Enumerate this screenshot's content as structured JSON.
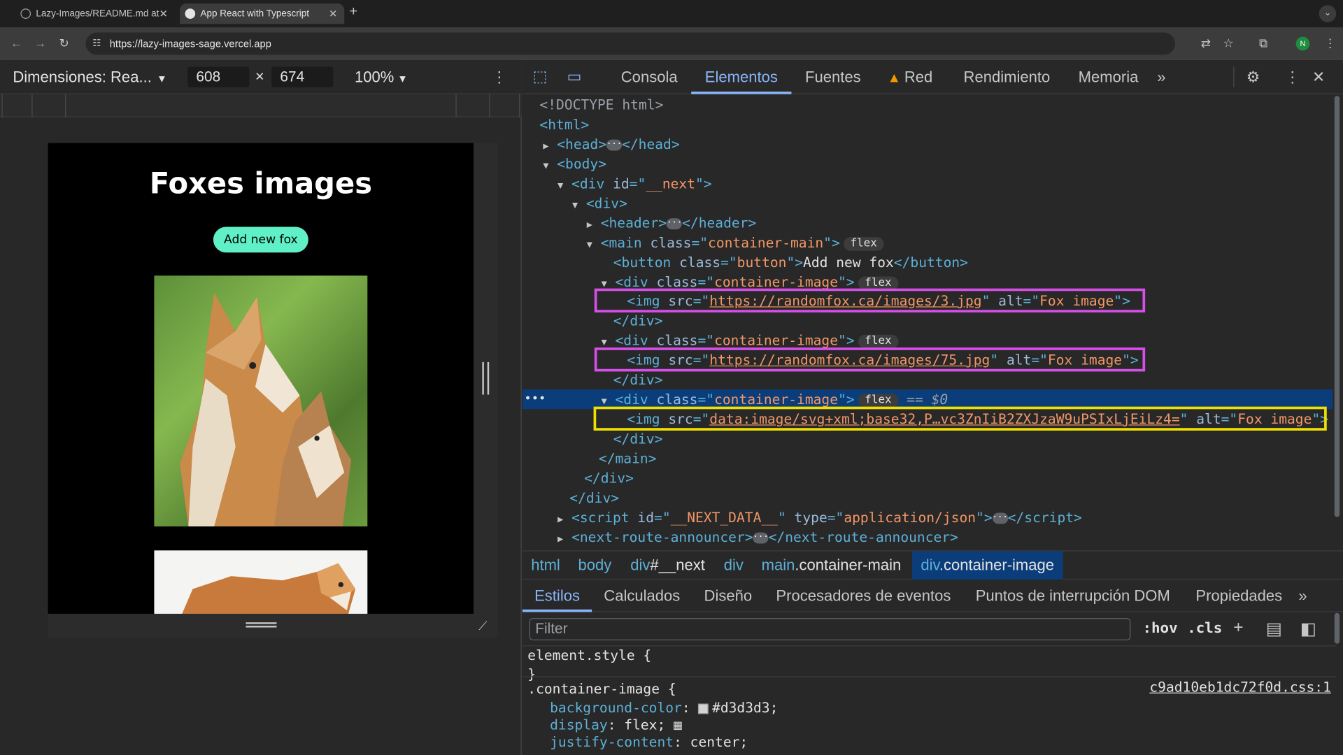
{
  "browser": {
    "tabs": [
      {
        "title": "Lazy-Images/README.md at",
        "active": false
      },
      {
        "title": "App React with Typescript",
        "active": true
      }
    ],
    "new_tab_symbol": "+",
    "url": "https://lazy-images-sage.vercel.app",
    "profile_initial": "N"
  },
  "device_toolbar": {
    "dimensions_label": "Dimensiones: Rea...",
    "width": "608",
    "height": "674",
    "times": "×",
    "zoom": "100%"
  },
  "page": {
    "title": "Foxes images",
    "add_button": "Add new fox"
  },
  "devtools": {
    "tabs": [
      "Consola",
      "Elementos",
      "Fuentes",
      "Red",
      "Rendimiento",
      "Memoria"
    ],
    "active_tab": "Elementos",
    "dom": {
      "doctype": "<!DOCTYPE html>",
      "eq_marker": "== $0",
      "flex_badge": "flex",
      "img1_src": "https://randomfox.ca/images/3.jpg",
      "img2_src": "https://randomfox.ca/images/75.jpg",
      "img3_src": "data:image/svg+xml;base32,P…vc3ZnIiB2ZXJzaW9uPSIxLjEiLz4=",
      "alt_value": "Fox image",
      "button_text": "Add new fox",
      "class_main": "container-main",
      "class_button": "button",
      "class_image": "container-image",
      "id_next": "__next",
      "id_next_data": "__NEXT_DATA__",
      "script_type": "application/json"
    },
    "breadcrumbs": [
      {
        "tag": "html",
        "cls": ""
      },
      {
        "tag": "body",
        "cls": ""
      },
      {
        "tag": "div",
        "cls": "#__next"
      },
      {
        "tag": "div",
        "cls": ""
      },
      {
        "tag": "main",
        "cls": ".container-main"
      },
      {
        "tag": "div",
        "cls": ".container-image"
      }
    ],
    "subtabs": [
      "Estilos",
      "Calculados",
      "Diseño",
      "Procesadores de eventos",
      "Puntos de interrupción DOM",
      "Propiedades"
    ],
    "filter_placeholder": "Filter",
    "hov": ":hov",
    "cls": ".cls",
    "styles": {
      "element_style": "element.style {",
      "close_brace": "}",
      "selector": ".container-image {",
      "source": "c9ad10eb1dc72f0d.css:1",
      "props": [
        {
          "name": "background-color",
          "value": "#d3d3d3;"
        },
        {
          "name": "display",
          "value": "flex;"
        },
        {
          "name": "justify-content",
          "value": "center;"
        }
      ],
      "swatch_color": "#d3d3d3"
    }
  }
}
